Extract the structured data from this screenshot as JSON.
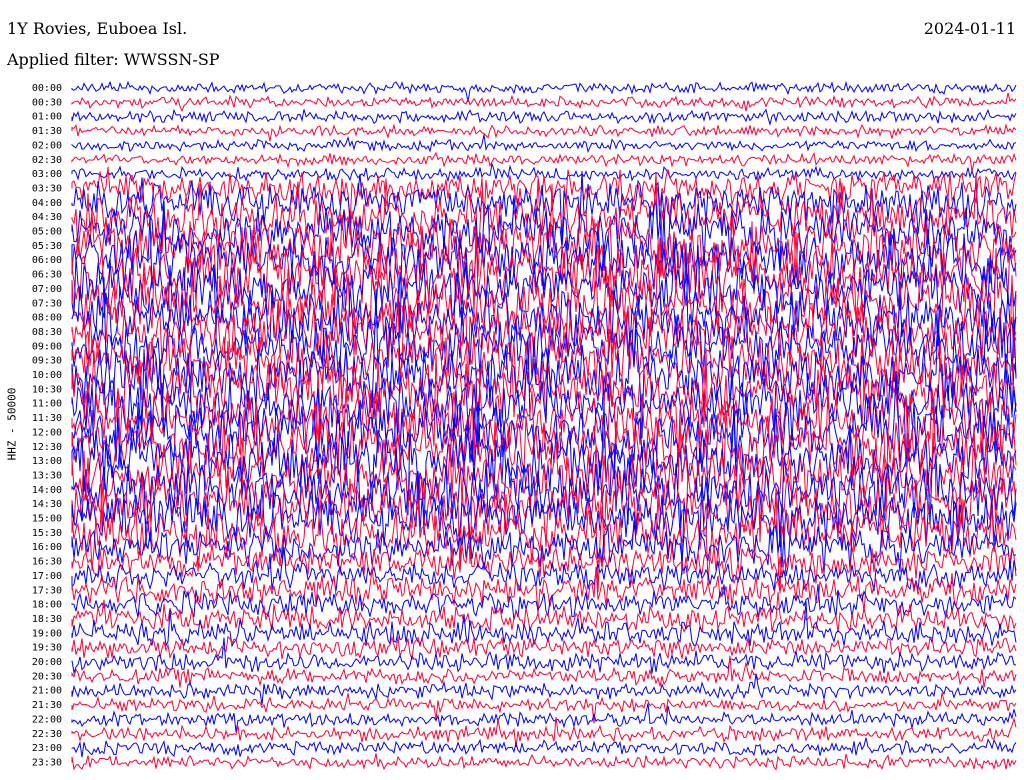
{
  "header": {
    "station": "1Y Rovies, Euboea Isl.",
    "date": "2024-01-11",
    "filter": "Applied filter: WWSSN-SP",
    "channel_label": "HHZ - 50000"
  },
  "colors": {
    "trace_a": "#0000ff",
    "trace_b": "#ff0033",
    "background": "#ffffff"
  },
  "chart_data": {
    "type": "helicorder",
    "row_labels": [
      "00:00",
      "00:30",
      "01:00",
      "01:30",
      "02:00",
      "02:30",
      "03:00",
      "03:30",
      "04:00",
      "04:30",
      "05:00",
      "05:30",
      "06:00",
      "06:30",
      "07:00",
      "07:30",
      "08:00",
      "08:30",
      "09:00",
      "09:30",
      "10:00",
      "10:30",
      "11:00",
      "11:30",
      "12:00",
      "12:30",
      "13:00",
      "13:30",
      "14:00",
      "14:30",
      "15:00",
      "15:30",
      "16:00",
      "16:30",
      "17:00",
      "17:30",
      "18:00",
      "18:30",
      "19:00",
      "19:30",
      "20:00",
      "20:30",
      "21:00",
      "21:30",
      "22:00",
      "22:30",
      "23:00",
      "23:30"
    ],
    "row_activity": [
      0.12,
      0.12,
      0.14,
      0.12,
      0.12,
      0.14,
      0.16,
      0.55,
      0.65,
      0.8,
      0.9,
      1.0,
      1.0,
      1.0,
      1.0,
      1.0,
      1.0,
      1.0,
      1.0,
      1.0,
      1.0,
      1.0,
      1.0,
      1.0,
      1.0,
      1.0,
      1.0,
      1.0,
      1.0,
      0.95,
      0.9,
      0.8,
      0.65,
      0.5,
      0.45,
      0.45,
      0.42,
      0.4,
      0.38,
      0.3,
      0.3,
      0.22,
      0.2,
      0.18,
      0.18,
      0.2,
      0.18,
      0.16
    ]
  }
}
